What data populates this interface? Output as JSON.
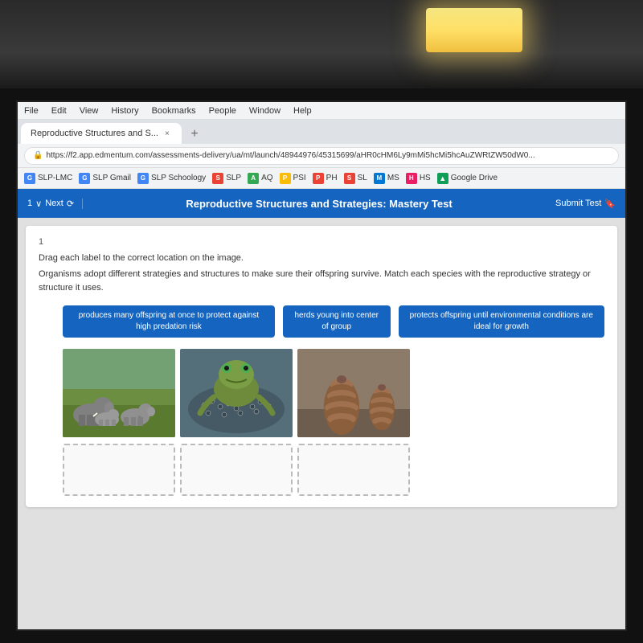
{
  "room": {
    "ceiling_light": "warm overhead light"
  },
  "browser": {
    "menu_items": [
      "File",
      "Edit",
      "View",
      "History",
      "Bookmarks",
      "People",
      "Window",
      "Help"
    ],
    "tab_title": "Reproductive Structures and S...",
    "tab_close": "×",
    "tab_plus": "+",
    "address_bar": {
      "lock_symbol": "🔒",
      "url": "https://f2.app.edmentum.com/assessments-delivery/ua/mt/launch/48944976/45315699/aHR0cHM6Ly9mMi5hcMi5hcAuZWRtZW50dW0..."
    },
    "bookmarks": [
      {
        "label": "SLP-LMC",
        "icon": "G",
        "color": "bk-g"
      },
      {
        "label": "SLP Gmail",
        "icon": "G",
        "color": "bk-g"
      },
      {
        "label": "SLP Schoology",
        "icon": "G",
        "color": "bk-g"
      },
      {
        "label": "SLP",
        "icon": "S",
        "color": "bk-slp"
      },
      {
        "label": "AQ",
        "icon": "A",
        "color": "bk-aq"
      },
      {
        "label": "PSI",
        "icon": "P",
        "color": "bk-psi"
      },
      {
        "label": "PH",
        "icon": "P",
        "color": "bk-slp"
      },
      {
        "label": "SL",
        "icon": "S",
        "color": "bk-slp"
      },
      {
        "label": "MS",
        "icon": "M",
        "color": "bk-ms"
      },
      {
        "label": "HS",
        "icon": "H",
        "color": "bk-hs"
      },
      {
        "label": "Google Drive",
        "icon": "▲",
        "color": "bk-drive"
      }
    ]
  },
  "test": {
    "nav_number": "1",
    "nav_next": "Next",
    "title": "Reproductive Structures and Strategies: Mastery Test",
    "submit_label": "Submit Test",
    "question_number": "1",
    "instruction": "Drag each label to the correct location on the image.",
    "body_text": "Organisms adopt different strategies and structures to make sure their offspring survive. Match each species with the reproductive strategy or structure it uses.",
    "labels": [
      "produces many offspring at once to protect against high predation risk",
      "herds young into center of group",
      "protects offspring until environmental conditions are ideal for growth"
    ],
    "images": [
      "elephants",
      "frog",
      "pine cone"
    ],
    "drop_zones": [
      "drop-zone-1",
      "drop-zone-2",
      "drop-zone-3"
    ]
  }
}
